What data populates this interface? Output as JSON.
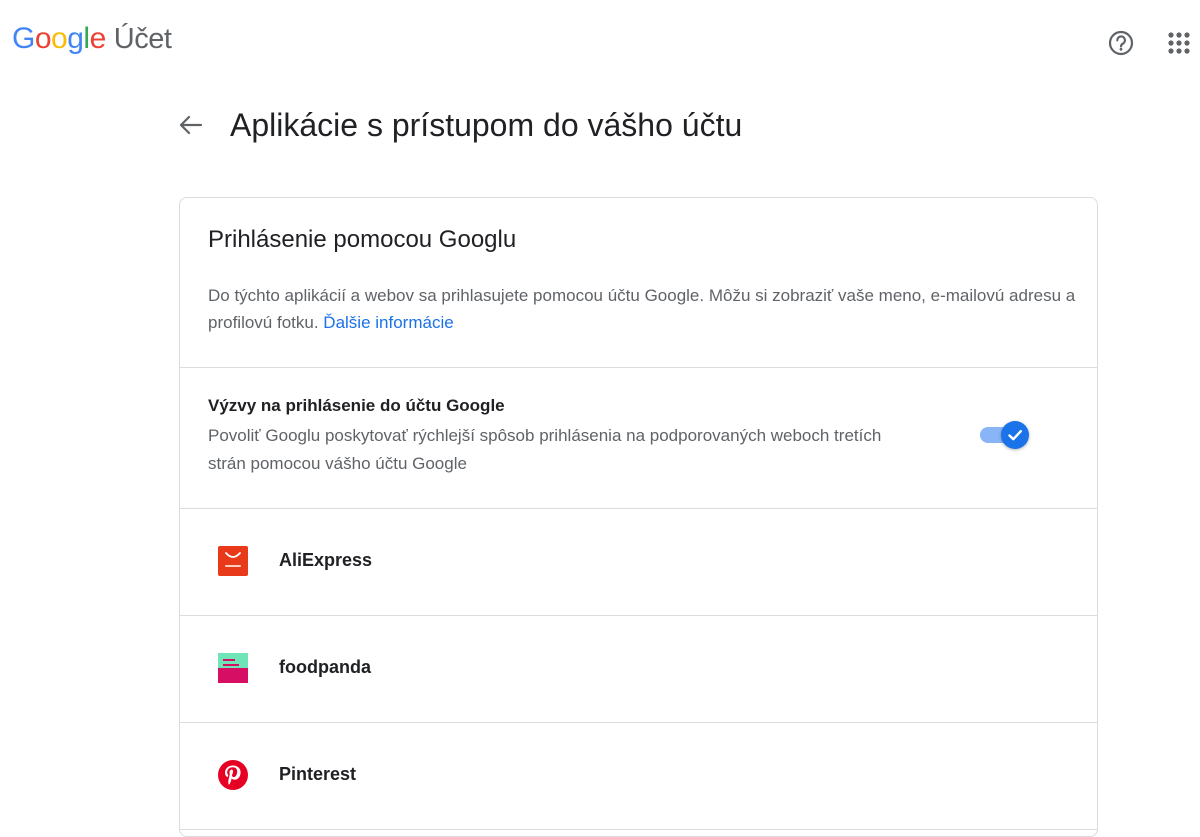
{
  "header": {
    "logo_letters": [
      "G",
      "o",
      "o",
      "g",
      "l",
      "e"
    ],
    "product_name": "Účet",
    "help_icon": "help-circle-icon",
    "apps_icon": "apps-grid-icon"
  },
  "page": {
    "back_icon": "arrow-back-icon",
    "title": "Aplikácie s prístupom do vášho účtu"
  },
  "card": {
    "title": "Prihlásenie pomocou Googlu",
    "description": "Do týchto aplikácií a webov sa prihlasujete pomocou účtu Google. Môžu si zobraziť vaše meno, e-mailovú adresu a profilovú fotku.",
    "learn_more": "Ďalšie informácie",
    "prompt": {
      "title": "Výzvy na prihlásenie do účtu Google",
      "description": "Povoliť Googlu poskytovať rýchlejší spôsob prihlásenia na podporovaných weboch tretích strán pomocou vášho účtu Google",
      "enabled": true
    },
    "apps": [
      {
        "name": "AliExpress",
        "icon": "aliexpress-icon"
      },
      {
        "name": "foodpanda",
        "icon": "foodpanda-icon"
      },
      {
        "name": "Pinterest",
        "icon": "pinterest-icon"
      }
    ]
  },
  "colors": {
    "link": "#1a73e8",
    "toggle_on": "#1a73e8",
    "divider": "#dadce0"
  }
}
